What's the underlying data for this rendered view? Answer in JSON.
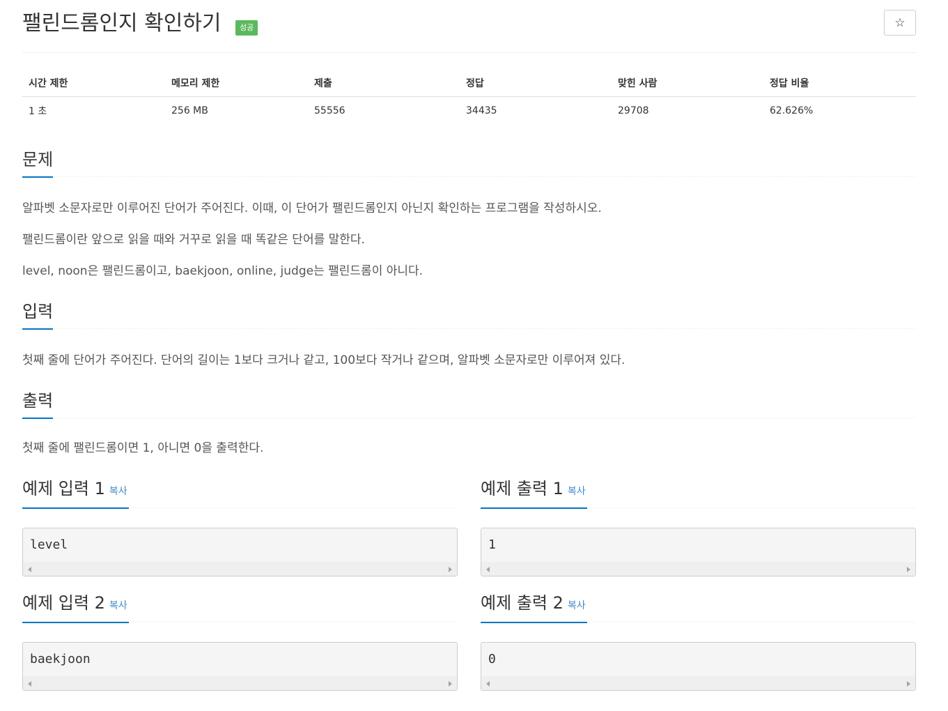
{
  "problem": {
    "title": "팰린드롬인지 확인하기",
    "badge": "성공",
    "star_icon": "☆"
  },
  "stats": {
    "headers": [
      "시간 제한",
      "메모리 제한",
      "제출",
      "정답",
      "맞힌 사람",
      "정답 비율"
    ],
    "values": [
      "1 초",
      "256 MB",
      "55556",
      "34435",
      "29708",
      "62.626%"
    ]
  },
  "sections": {
    "description": {
      "heading": "문제",
      "paragraphs": [
        "알파벳 소문자로만 이루어진 단어가 주어진다. 이때, 이 단어가 팰린드롬인지 아닌지 확인하는 프로그램을 작성하시오.",
        "팰린드롬이란 앞으로 읽을 때와 거꾸로 읽을 때 똑같은 단어를 말한다.",
        "level, noon은 팰린드롬이고, baekjoon, online, judge는 팰린드롬이 아니다."
      ]
    },
    "input": {
      "heading": "입력",
      "text": "첫째 줄에 단어가 주어진다. 단어의 길이는 1보다 크거나 같고, 100보다 작거나 같으며, 알파벳 소문자로만 이루어져 있다."
    },
    "output": {
      "heading": "출력",
      "text": "첫째 줄에 팰린드롬이면 1, 아니면 0을 출력한다."
    }
  },
  "examples": [
    {
      "input_title": "예제 입력 1",
      "output_title": "예제 출력 1",
      "copy_label": "복사",
      "input": "level",
      "output": "1"
    },
    {
      "input_title": "예제 입력 2",
      "output_title": "예제 출력 2",
      "copy_label": "복사",
      "input": "baekjoon",
      "output": "0"
    }
  ],
  "colors": {
    "badge_success": "#5cb85c",
    "accent_underline": "#0076c0",
    "copy_link": "#428bca"
  }
}
